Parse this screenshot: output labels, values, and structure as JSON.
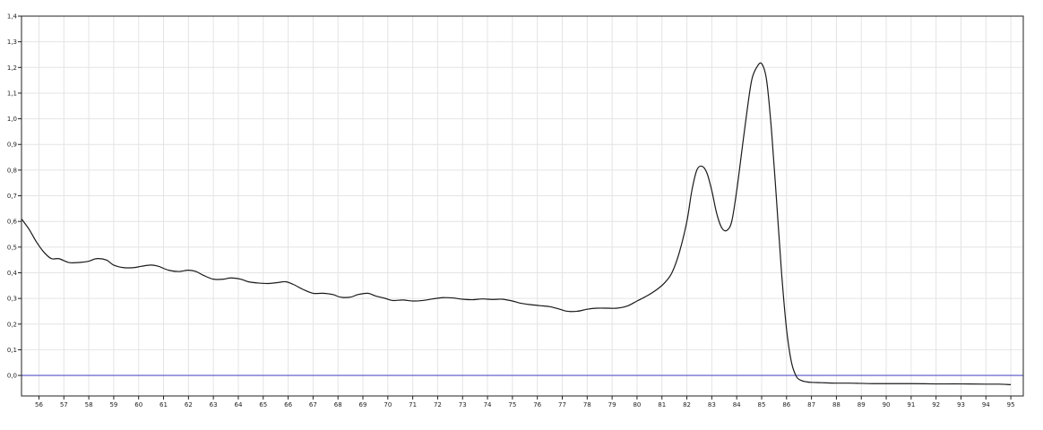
{
  "chart_data": {
    "type": "line",
    "title": "",
    "xlabel": "",
    "ylabel": "",
    "xlim": [
      55.3,
      95.5
    ],
    "ylim": [
      -0.08,
      1.4
    ],
    "x_ticks": [
      56,
      57,
      58,
      59,
      60,
      61,
      62,
      63,
      64,
      65,
      66,
      67,
      68,
      69,
      70,
      71,
      72,
      73,
      74,
      75,
      76,
      77,
      78,
      79,
      80,
      81,
      82,
      83,
      84,
      85,
      86,
      87,
      88,
      89,
      90,
      91,
      92,
      93,
      94,
      95
    ],
    "y_ticks": [
      0.0,
      0.1,
      0.2,
      0.3,
      0.4,
      0.5,
      0.6,
      0.7,
      0.8,
      0.9,
      1.0,
      1.1,
      1.2,
      1.3,
      1.4
    ],
    "y_tick_labels": [
      "0,0",
      "0,1",
      "0,2",
      "0,3",
      "0,4",
      "0,5",
      "0,6",
      "0,7",
      "0,8",
      "0,9",
      "1,0",
      "1,1",
      "1,2",
      "1,3",
      "1,4"
    ],
    "grid": true,
    "colors": {
      "series": "#1a1a1a",
      "baseline": "#5555cc",
      "grid": "#e4e4e4",
      "frame": "#222222"
    },
    "baseline": {
      "y": 0.0
    },
    "series": [
      {
        "x": [
          55.3,
          55.6,
          55.9,
          56.2,
          56.5,
          56.8,
          57.2,
          57.6,
          58.0,
          58.3,
          58.7,
          59.0,
          59.4,
          59.8,
          60.1,
          60.5,
          60.8,
          61.2,
          61.6,
          62.0,
          62.3,
          62.6,
          63.0,
          63.4,
          63.7,
          64.1,
          64.4,
          64.8,
          65.2,
          65.6,
          65.9,
          66.2,
          66.6,
          67.0,
          67.4,
          67.8,
          68.1,
          68.5,
          68.8,
          69.2,
          69.5,
          69.9,
          70.2,
          70.6,
          71.0,
          71.4,
          71.8,
          72.2,
          72.6,
          73.0,
          73.4,
          73.8,
          74.2,
          74.6,
          75.0,
          75.3,
          75.7,
          76.1,
          76.5,
          76.9,
          77.2,
          77.6,
          78.0,
          78.4,
          78.8,
          79.2,
          79.6,
          80.0,
          80.4,
          80.8,
          81.1,
          81.4,
          81.7,
          82.0,
          82.2,
          82.4,
          82.6,
          82.8,
          83.0,
          83.2,
          83.4,
          83.6,
          83.8,
          84.0,
          84.2,
          84.4,
          84.6,
          84.8,
          85.0,
          85.2,
          85.4,
          85.6,
          85.8,
          86.0,
          86.2,
          86.4,
          86.6,
          86.8,
          87.0,
          87.3,
          87.6,
          88.0,
          88.5,
          89.0,
          89.5,
          90.0,
          91.0,
          92.0,
          93.0,
          94.0,
          94.5,
          95.0
        ],
        "y": [
          0.61,
          0.57,
          0.52,
          0.48,
          0.455,
          0.455,
          0.44,
          0.44,
          0.445,
          0.455,
          0.45,
          0.43,
          0.42,
          0.42,
          0.425,
          0.43,
          0.425,
          0.41,
          0.405,
          0.41,
          0.405,
          0.39,
          0.375,
          0.375,
          0.38,
          0.375,
          0.365,
          0.36,
          0.358,
          0.362,
          0.365,
          0.355,
          0.335,
          0.32,
          0.32,
          0.315,
          0.305,
          0.305,
          0.315,
          0.32,
          0.31,
          0.3,
          0.292,
          0.294,
          0.29,
          0.292,
          0.298,
          0.303,
          0.302,
          0.297,
          0.295,
          0.298,
          0.296,
          0.297,
          0.29,
          0.282,
          0.276,
          0.272,
          0.268,
          0.258,
          0.25,
          0.25,
          0.258,
          0.262,
          0.262,
          0.262,
          0.27,
          0.29,
          0.31,
          0.335,
          0.36,
          0.4,
          0.48,
          0.6,
          0.72,
          0.8,
          0.815,
          0.79,
          0.72,
          0.63,
          0.575,
          0.565,
          0.6,
          0.72,
          0.87,
          1.02,
          1.15,
          1.2,
          1.215,
          1.15,
          0.95,
          0.68,
          0.4,
          0.18,
          0.05,
          -0.005,
          -0.02,
          -0.025,
          -0.027,
          -0.028,
          -0.029,
          -0.03,
          -0.03,
          -0.031,
          -0.032,
          -0.032,
          -0.032,
          -0.033,
          -0.033,
          -0.034,
          -0.034,
          -0.036
        ]
      }
    ]
  }
}
